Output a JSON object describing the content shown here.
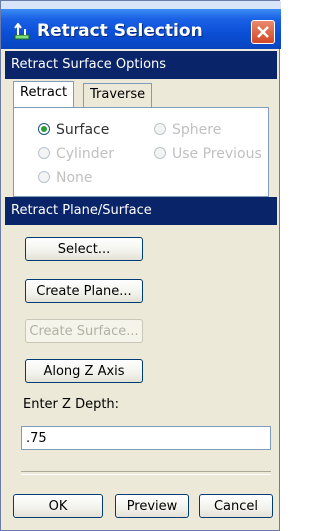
{
  "window": {
    "title": "Retract Selection"
  },
  "surface_options": {
    "header": "Retract Surface Options"
  },
  "tabs": [
    {
      "label": "Retract"
    },
    {
      "label": "Traverse"
    }
  ],
  "radios": [
    {
      "label": "Surface",
      "checked": true,
      "enabled": true
    },
    {
      "label": "Sphere",
      "checked": false,
      "enabled": false
    },
    {
      "label": "Cylinder",
      "checked": false,
      "enabled": false
    },
    {
      "label": "Use Previous",
      "checked": false,
      "enabled": false
    },
    {
      "label": "None",
      "checked": false,
      "enabled": false
    }
  ],
  "plane_section": {
    "header": "Retract Plane/Surface"
  },
  "buttons": {
    "select": "Select...",
    "create_plane": "Create Plane...",
    "create_surface": "Create Surface...",
    "along_z": "Along Z Axis"
  },
  "depth": {
    "label": "Enter Z Depth:",
    "value": ".75"
  },
  "footer": {
    "ok": "OK",
    "preview": "Preview",
    "cancel": "Cancel"
  },
  "colors": {
    "titlebar": "#0b4fd6",
    "section_header": "#0a246a",
    "window_bg": "#ece9d8",
    "close": "#d14825"
  }
}
